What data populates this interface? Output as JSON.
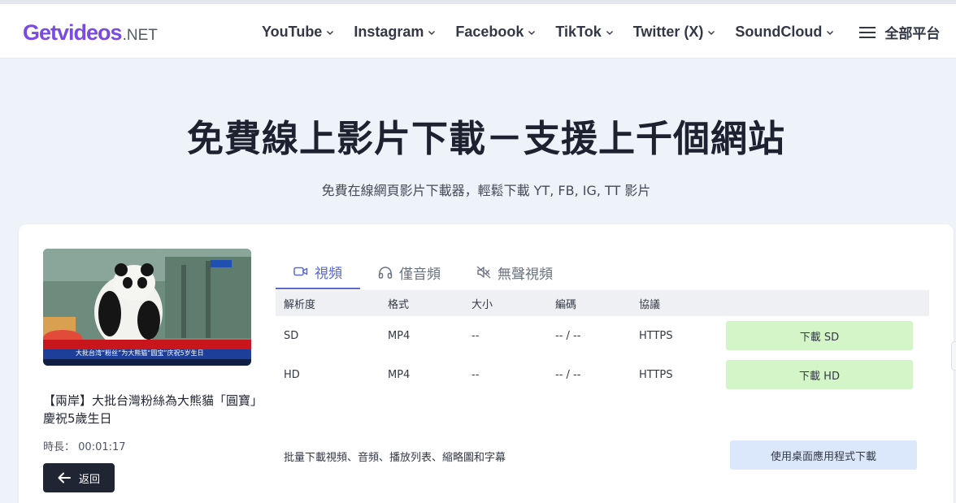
{
  "logo": {
    "get": "Get",
    "videos": "videos",
    "net": ".NET"
  },
  "nav": {
    "items": [
      {
        "label": "YouTube"
      },
      {
        "label": "Instagram"
      },
      {
        "label": "Facebook"
      },
      {
        "label": "TikTok"
      },
      {
        "label": "Twitter (X)"
      },
      {
        "label": "SoundCloud"
      }
    ],
    "all_platforms": "全部平台"
  },
  "hero": {
    "title": "免費線上影片下載－支援上千個網站",
    "subtitle": "免費在線網頁影片下載器，輕鬆下載 YT, FB, IG, TT 影片"
  },
  "video": {
    "thumbnail_caption": "大批台湾“粉丝”为大熊猫“圆宝”庆祝5岁生日",
    "title": "【兩岸】大批台灣粉絲為大熊貓「圓寶」慶祝5歲生日",
    "duration_label": "時長：",
    "duration": "00:01:17",
    "back_label": "返回"
  },
  "tabs": [
    {
      "label": "視頻",
      "icon": "video-camera-icon",
      "active": true
    },
    {
      "label": "僅音頻",
      "icon": "headphones-icon",
      "active": false
    },
    {
      "label": "無聲視頻",
      "icon": "muted-speaker-icon",
      "active": false
    }
  ],
  "table": {
    "headers": [
      "解析度",
      "格式",
      "大小",
      "編碼",
      "協議"
    ],
    "rows": [
      {
        "resolution": "SD",
        "format": "MP4",
        "size": "--",
        "codec": "-- / --",
        "protocol": "HTTPS",
        "button": "下載 SD"
      },
      {
        "resolution": "HD",
        "format": "MP4",
        "size": "--",
        "codec": "-- / --",
        "protocol": "HTTPS",
        "button": "下載 HD"
      }
    ]
  },
  "footer": {
    "batch_text": "批量下載視頻、音頻、播放列表、縮略圖和字幕",
    "app_button": "使用桌面應用程式下載"
  },
  "colors": {
    "accent": "#5a6ad1",
    "logo": "#7a4be0",
    "download_button": "#d4f5c7",
    "app_button": "#dbe8fb",
    "back_button": "#1f2533",
    "page_bg": "#eef2f9"
  }
}
